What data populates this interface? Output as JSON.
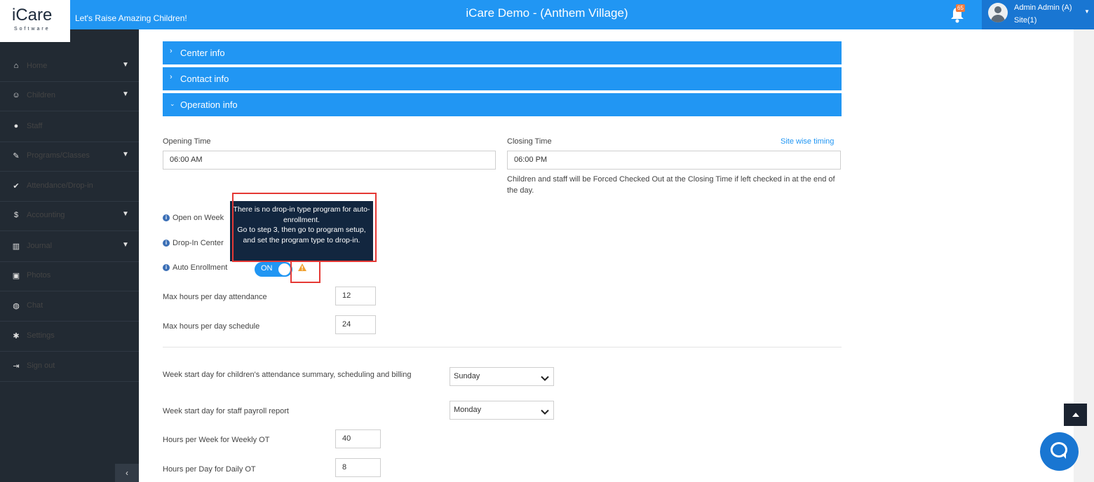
{
  "header": {
    "logo_text": "iCare",
    "logo_sub": "Software",
    "tagline": "Let's Raise Amazing Children!",
    "title": "iCare Demo - (Anthem Village)",
    "notification_count": "65",
    "user_name": "Admin Admin (A)",
    "user_site": "Site(1)"
  },
  "sidebar": {
    "items": [
      {
        "label": "Home",
        "icon": "home-icon",
        "glyph": "⌂",
        "caret": true
      },
      {
        "label": "Children",
        "icon": "smile-icon",
        "glyph": "☺",
        "caret": true
      },
      {
        "label": "Staff",
        "icon": "user-icon",
        "glyph": "●",
        "caret": false
      },
      {
        "label": "Programs/Classes",
        "icon": "pencil-icon",
        "glyph": "✎",
        "caret": true
      },
      {
        "label": "Attendance/Drop-in",
        "icon": "check-circle-icon",
        "glyph": "✔",
        "caret": false
      },
      {
        "label": "Accounting",
        "icon": "dollar-icon",
        "glyph": "$",
        "caret": true
      },
      {
        "label": "Journal",
        "icon": "bar-chart-icon",
        "glyph": "▥",
        "caret": true
      },
      {
        "label": "Photos",
        "icon": "photo-icon",
        "glyph": "▣",
        "caret": false
      },
      {
        "label": "Chat",
        "icon": "chat-icon",
        "glyph": "◍",
        "caret": false
      },
      {
        "label": "Settings",
        "icon": "gear-icon",
        "glyph": "✱",
        "caret": false
      },
      {
        "label": "Sign out",
        "icon": "sign-out-icon",
        "glyph": "⇥",
        "caret": false
      }
    ],
    "collapse_glyph": "‹"
  },
  "sections": {
    "center_info": "Center info",
    "contact_info": "Contact info",
    "operation_info": "Operation info"
  },
  "form": {
    "opening_time_label": "Opening Time",
    "opening_time_value": "06:00 AM",
    "closing_time_label": "Closing Time",
    "closing_time_value": "06:00 PM",
    "site_wise_timing": "Site wise timing",
    "closing_note": "Children and staff will be Forced Checked Out at the Closing Time if left checked in at the end of the day.",
    "open_on_weekends_label": "Open on Week",
    "drop_in_center_label": "Drop-In Center",
    "auto_enrollment_label": "Auto Enrollment",
    "auto_enrollment_state": "ON",
    "max_hours_attendance_label": "Max hours per day attendance",
    "max_hours_attendance_value": "12",
    "max_hours_schedule_label": "Max hours per day schedule",
    "max_hours_schedule_value": "24",
    "week_start_children_label": "Week start day for children's attendance summary, scheduling and billing",
    "week_start_children_value": "Sunday",
    "week_start_staff_label": "Week start day for staff payroll report",
    "week_start_staff_value": "Monday",
    "weekly_ot_label": "Hours per Week for Weekly OT",
    "weekly_ot_value": "40",
    "daily_ot_label": "Hours per Day for Daily OT",
    "daily_ot_value": "8"
  },
  "tooltip": {
    "line1": "There is no drop-in type program for auto-enrollment.",
    "line2": "Go to step 3, then go to program setup, and set the program type to drop-in."
  },
  "colors": {
    "primary": "#2196f3",
    "sidebar": "#222a33",
    "tooltip": "#12263f",
    "highlight": "#e53935",
    "warning": "#f0a030"
  }
}
